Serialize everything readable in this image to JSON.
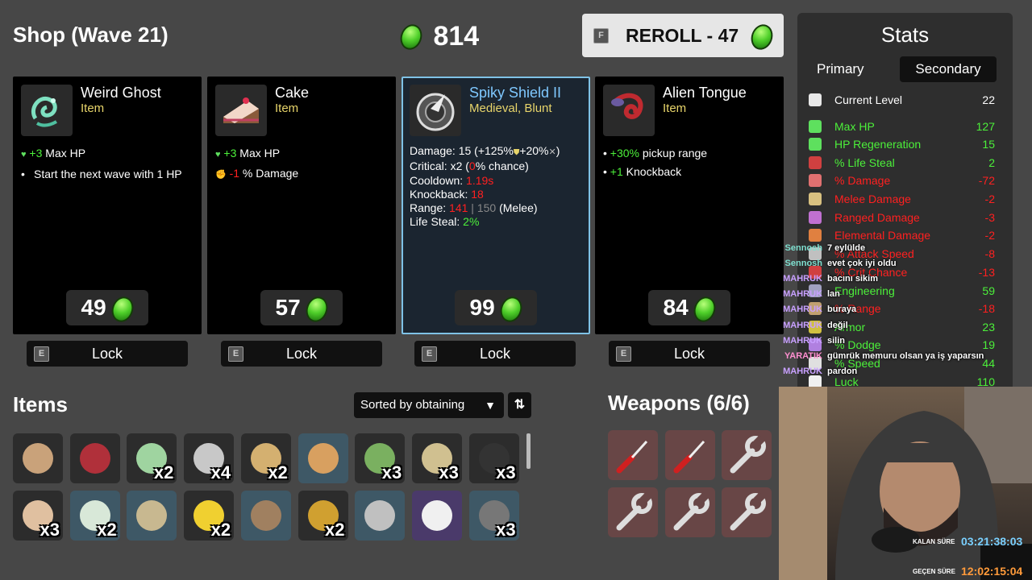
{
  "shop": {
    "title": "Shop (Wave 21)",
    "currency": "814"
  },
  "reroll": {
    "key": "F",
    "label": "REROLL - 47"
  },
  "cards": [
    {
      "name": "Weird Ghost",
      "type": "Item",
      "price": "49",
      "lines": [
        {
          "bullet": "heart",
          "plain": "",
          "pos": "+3",
          "neg": "",
          "text": " Max HP"
        },
        {
          "bullet": "dot",
          "plain": "Start the next wave with 1 HP",
          "pos": "",
          "neg": "",
          "text": ""
        }
      ]
    },
    {
      "name": "Cake",
      "type": "Item",
      "price": "57",
      "lines": [
        {
          "bullet": "heart",
          "plain": "",
          "pos": "+3",
          "neg": "",
          "text": " Max HP"
        },
        {
          "bullet": "fist",
          "plain": "",
          "pos": "",
          "neg": "-1",
          "text": " % Damage"
        }
      ]
    },
    {
      "name": "Spiky Shield II",
      "type": "Medieval, Blunt",
      "price": "99",
      "weapon": {
        "damage_label": "Damage:",
        "damage": "15 (+125%",
        "damage_b": "+20%",
        "damage_c": ")",
        "crit_label": "Critical:",
        "crit": "x2 (",
        "crit_chance": "0",
        "crit_end": "% chance)",
        "cooldown_label": "Cooldown:",
        "cooldown": "1.19s",
        "knockback_label": "Knockback:",
        "knockback": "18",
        "range_label": "Range:",
        "range": "141",
        "range_sep": "|",
        "range_base": "150",
        "range_end": "(Melee)",
        "lifesteal_label": "Life Steal:",
        "lifesteal": "2%"
      }
    },
    {
      "name": "Alien Tongue",
      "type": "Item",
      "price": "84",
      "lines": [
        {
          "bullet": "dot",
          "plain": "",
          "pos": "+30%",
          "neg": "",
          "text": " pickup range"
        },
        {
          "bullet": "dot",
          "plain": "",
          "pos": "+1",
          "neg": "",
          "text": " Knockback"
        }
      ]
    }
  ],
  "lock": {
    "key": "E",
    "label": "Lock"
  },
  "items": {
    "title": "Items",
    "sort_label": "Sorted by obtaining",
    "slots": [
      {
        "icon": "bearded-face-icon",
        "count": "",
        "style": "normal"
      },
      {
        "icon": "plaid-shirt-icon",
        "count": "",
        "style": "normal"
      },
      {
        "icon": "broccoli-sack-icon",
        "count": "x2",
        "style": "normal"
      },
      {
        "icon": "scarf-icon",
        "count": "x4",
        "style": "normal"
      },
      {
        "icon": "pencil-icon",
        "count": "x2",
        "style": "normal"
      },
      {
        "icon": "snail-icon",
        "count": "",
        "style": "blue"
      },
      {
        "icon": "alien-map-icon",
        "count": "x3",
        "style": "normal"
      },
      {
        "icon": "padlock-icon",
        "count": "x3",
        "style": "normal"
      },
      {
        "icon": "helmet-icon",
        "count": "x3",
        "style": "normal"
      },
      {
        "icon": "bandaged-face-icon",
        "count": "x3",
        "style": "normal"
      },
      {
        "icon": "medkit-icon",
        "count": "x2",
        "style": "blue"
      },
      {
        "icon": "mirror-icon",
        "count": "",
        "style": "blue"
      },
      {
        "icon": "rubber-duck-icon",
        "count": "x2",
        "style": "normal"
      },
      {
        "icon": "garden-plot-icon",
        "count": "",
        "style": "blue"
      },
      {
        "icon": "wasp-icon",
        "count": "x2",
        "style": "normal"
      },
      {
        "icon": "factory-icon",
        "count": "",
        "style": "blue"
      },
      {
        "icon": "cup-icon",
        "count": "",
        "style": "purple"
      },
      {
        "icon": "horseshoe-icon",
        "count": "x3",
        "style": "blue"
      }
    ]
  },
  "weapons": {
    "title": "Weapons (6/6)",
    "slots": [
      "screwdriver-icon",
      "screwdriver-icon",
      "wrench-icon",
      "wrench-icon",
      "wrench-icon",
      "wrench-icon"
    ]
  },
  "stats": {
    "title": "Stats",
    "tab_primary": "Primary",
    "tab_secondary": "Secondary",
    "rows": [
      {
        "name": "Current Level",
        "value": "22",
        "color": "#ffffff",
        "icon": "#e8e8e8"
      },
      {
        "name": "Max HP",
        "value": "127",
        "color": "#4cf03a",
        "icon": "#5ee05e"
      },
      {
        "name": "HP Regeneration",
        "value": "15",
        "color": "#4cf03a",
        "icon": "#5ee05e"
      },
      {
        "name": "% Life Steal",
        "value": "2",
        "color": "#4cf03a",
        "icon": "#d04040"
      },
      {
        "name": "% Damage",
        "value": "-72",
        "color": "#ff2020",
        "icon": "#e07070"
      },
      {
        "name": "Melee Damage",
        "value": "-2",
        "color": "#ff2020",
        "icon": "#d8c080"
      },
      {
        "name": "Ranged Damage",
        "value": "-3",
        "color": "#ff2020",
        "icon": "#c070d0"
      },
      {
        "name": "Elemental Damage",
        "value": "-2",
        "color": "#ff2020",
        "icon": "#e08040"
      },
      {
        "name": "% Attack Speed",
        "value": "-8",
        "color": "#ff2020",
        "icon": "#c0c0c0"
      },
      {
        "name": "% Crit Chance",
        "value": "-13",
        "color": "#ff2020",
        "icon": "#d04040"
      },
      {
        "name": "Engineering",
        "value": "59",
        "color": "#4cf03a",
        "icon": "#a0a0c0"
      },
      {
        "name": "% Range",
        "value": "-18",
        "color": "#ff2020",
        "icon": "#c0a070"
      },
      {
        "name": "Armor",
        "value": "23",
        "color": "#4cf03a",
        "icon": "#d0c040"
      },
      {
        "name": "% Dodge",
        "value": "19",
        "color": "#4cf03a",
        "icon": "#b080e0"
      },
      {
        "name": "% Speed",
        "value": "44",
        "color": "#4cf03a",
        "icon": "#e0e0e0"
      },
      {
        "name": "Luck",
        "value": "110",
        "color": "#4cf03a",
        "icon": "#f0f0f0"
      }
    ]
  },
  "chat": [
    {
      "user": "Sennosh",
      "msg": "7 eylülde",
      "color": "#7fe0d0"
    },
    {
      "user": "Sennosh",
      "msg": "evet çok iyi oldu",
      "color": "#7fe0d0"
    },
    {
      "user": "MAHRUK",
      "msg": "bacını sikim",
      "color": "#c8a0ff"
    },
    {
      "user": "MAHRUK",
      "msg": "lan",
      "color": "#c8a0ff"
    },
    {
      "user": "MAHRUK",
      "msg": "buraya",
      "color": "#c8a0ff"
    },
    {
      "user": "MAHRUK",
      "msg": "değil",
      "color": "#c8a0ff"
    },
    {
      "user": "MAHRUK",
      "msg": "silin",
      "color": "#c8a0ff"
    },
    {
      "user": "YARATIK",
      "msg": "gümrük memuru olsan ya iş yaparsın",
      "color": "#ff8fd0"
    },
    {
      "user": "MAHRUK",
      "msg": "pardon",
      "color": "#c8a0ff"
    }
  ],
  "overlay": {
    "remaining_label": "KALAN SÜRE",
    "remaining": "03:21:38:03",
    "elapsed_label": "GEÇEN SÜRE",
    "elapsed": "12:02:15:04"
  }
}
